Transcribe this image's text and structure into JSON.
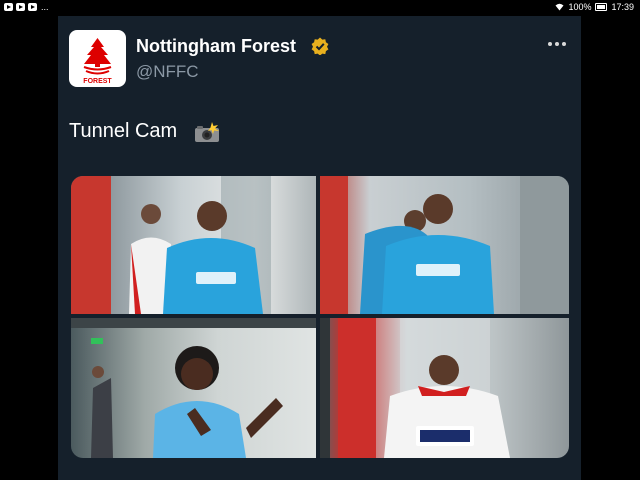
{
  "statusbar": {
    "dots": "...",
    "battery": "100%",
    "time": "17:39"
  },
  "tweet": {
    "display_name": "Nottingham Forest",
    "handle": "@NFFC",
    "text": "Tunnel Cam"
  },
  "icons": {
    "logo": "forest-tree-logo",
    "verified": "verified-badge-icon",
    "more": "more-options-icon",
    "camera": "camera-flash-emoji"
  },
  "logo": {
    "text": "FOREST"
  },
  "photos": [
    {
      "id": "p1",
      "sponsor": "kalyun"
    },
    {
      "id": "p2",
      "sponsor": "kalyun"
    },
    {
      "id": "p3"
    },
    {
      "id": "p4",
      "sponsor": "e·on next"
    }
  ],
  "colors": {
    "background": "#15202b",
    "primary_text": "#ffffff",
    "secondary_text": "#8b98a5",
    "verified": "#e8b01e",
    "club_red": "#dd0000"
  }
}
